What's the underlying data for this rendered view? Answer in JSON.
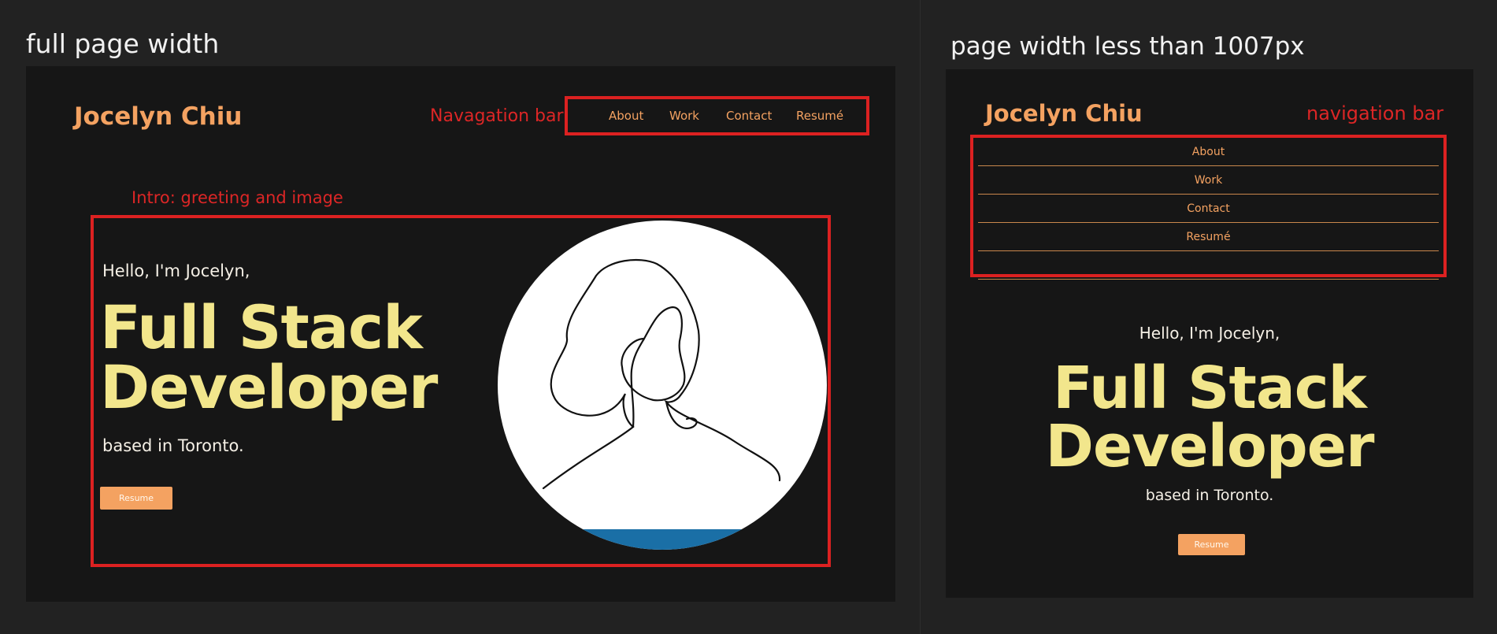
{
  "left_view": {
    "caption": "full page width",
    "logo": "Jocelyn Chiu",
    "nav_annotation": "Navagation bar",
    "nav": {
      "items": [
        {
          "label": "About"
        },
        {
          "label": "Work"
        },
        {
          "label": "Contact"
        },
        {
          "label": "Resumé"
        }
      ]
    },
    "intro_annotation": "Intro: greeting and image",
    "greeting": "Hello, I'm Jocelyn,",
    "headline_line1": "Full Stack",
    "headline_line2": "Developer",
    "location": "based in Toronto.",
    "resume_button": "Resume"
  },
  "right_view": {
    "caption": "page width less than 1007px",
    "logo": "Jocelyn Chiu",
    "nav_annotation": "navigation bar",
    "nav": {
      "items": [
        {
          "label": "About"
        },
        {
          "label": "Work"
        },
        {
          "label": "Contact"
        },
        {
          "label": "Resumé"
        }
      ]
    },
    "greeting": "Hello, I'm Jocelyn,",
    "headline_line1": "Full Stack",
    "headline_line2": "Developer",
    "location": "based in Toronto.",
    "resume_button": "Resume"
  },
  "colors": {
    "background": "#222222",
    "panel": "#161616",
    "accent_orange": "#f4a261",
    "headline_yellow": "#f2e68c",
    "annotation_red": "#dc2121",
    "avatar_strip_blue": "#1a6fa6"
  }
}
